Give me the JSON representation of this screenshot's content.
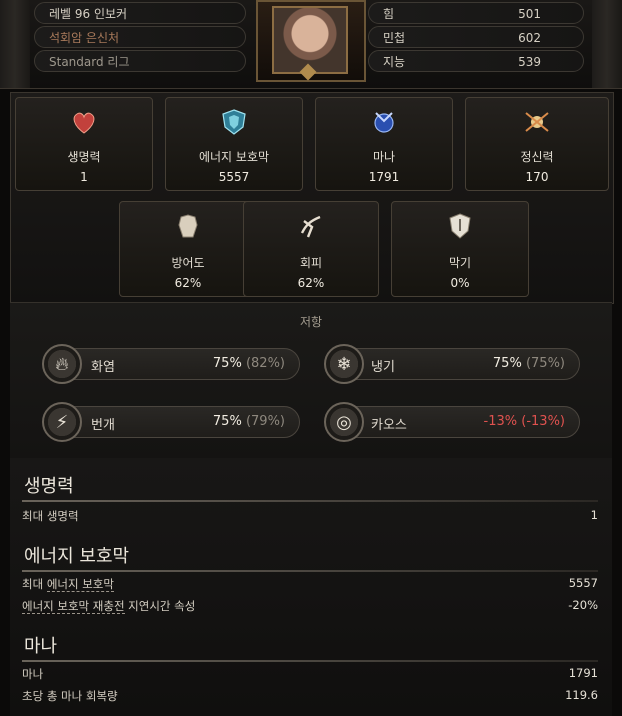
{
  "header": {
    "level_class": "레벨 96 인보커",
    "ascendancy": "석회암 은신처",
    "league": "Standard 리그",
    "attributes": [
      {
        "label": "힘",
        "value": "501"
      },
      {
        "label": "민첩",
        "value": "602"
      },
      {
        "label": "지능",
        "value": "539"
      }
    ]
  },
  "primary_stats": [
    {
      "label": "생명력",
      "value": "1",
      "icon": "heart-icon"
    },
    {
      "label": "에너지 보호막",
      "value": "5557",
      "icon": "energy-shield-icon"
    },
    {
      "label": "마나",
      "value": "1791",
      "icon": "mana-icon"
    },
    {
      "label": "정신력",
      "value": "170",
      "icon": "spirit-icon"
    }
  ],
  "defence_stats": [
    {
      "label": "방어도",
      "value": "62%",
      "icon": "armour-icon"
    },
    {
      "label": "회피",
      "value": "62%",
      "icon": "evasion-icon"
    },
    {
      "label": "막기",
      "value": "0%",
      "icon": "block-shield-icon"
    }
  ],
  "resistances": {
    "title": "저항",
    "items": [
      {
        "label": "화염",
        "value": "75%",
        "max": "(82%)",
        "icon": "fire-icon"
      },
      {
        "label": "냉기",
        "value": "75%",
        "max": "(75%)",
        "icon": "cold-icon"
      },
      {
        "label": "번개",
        "value": "75%",
        "max": "(79%)",
        "icon": "lightning-icon"
      },
      {
        "label": "카오스",
        "value": "-13%",
        "max": "(-13%)",
        "icon": "chaos-icon"
      }
    ]
  },
  "details": [
    {
      "title": "생명력",
      "rows": [
        {
          "label": "최대 생명력",
          "value": "1"
        }
      ]
    },
    {
      "title": "에너지 보호막",
      "rows": [
        {
          "label_pre": "최대 ",
          "label_u": "에너지 보호막",
          "label_post": "",
          "value": "5557"
        },
        {
          "label_pre": "",
          "label_u": "에너지 보호막 재충전",
          "label_post": " 지연시간 속성",
          "value": "-20%"
        }
      ]
    },
    {
      "title": "마나",
      "rows": [
        {
          "label": "마나",
          "value": "1791"
        },
        {
          "label": "초당 총 마나 회복량",
          "value": "119.6"
        }
      ]
    }
  ],
  "colors": {
    "negative": "#e0524f",
    "panel": "#1d1b19",
    "border": "#463f35"
  }
}
